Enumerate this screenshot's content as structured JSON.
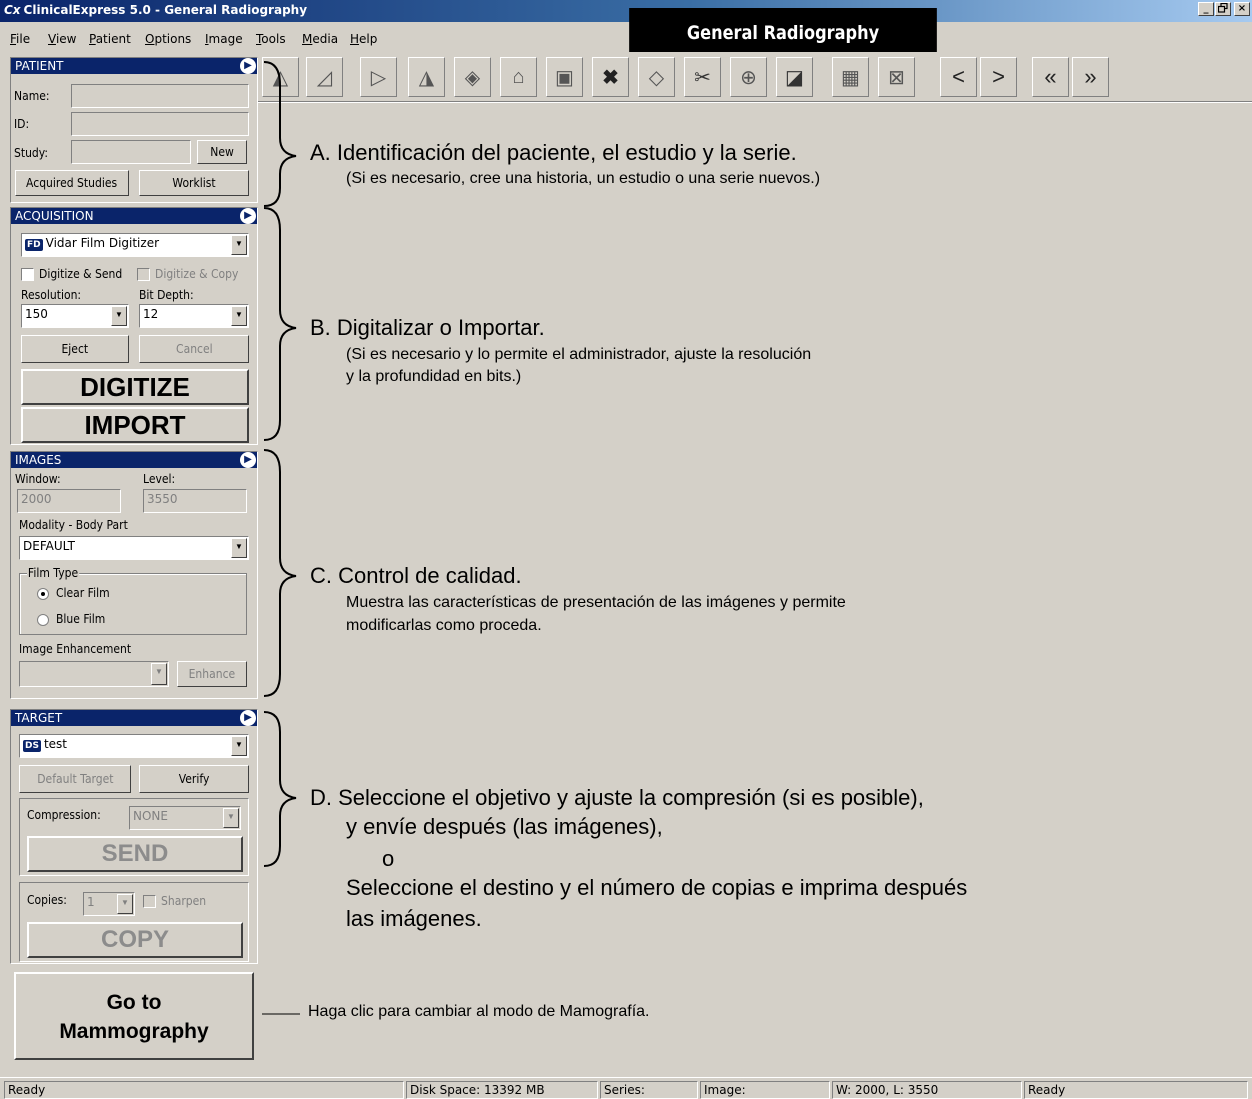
{
  "window": {
    "title": "ClinicalExpress 5.0 - General Radiography",
    "icon_glyph": "Cx",
    "minimize": "_",
    "restore": "Р",
    "close": "×"
  },
  "menu": [
    "File",
    "View",
    "Patient",
    "Options",
    "Image",
    "Tools",
    "Media",
    "Help"
  ],
  "mode_banner": "General Radiography",
  "toolbar": {
    "tools": [
      "flip-horizontal-icon",
      "rotate-icon",
      "arrow-icon",
      "mirror-icon",
      "fit-icon",
      "home-icon",
      "page-icon",
      "delete-icon",
      "fill-icon",
      "tools-icon",
      "zoom-icon",
      "label-icon",
      "grid-icon",
      "crosshair-icon"
    ],
    "nav": [
      "<",
      ">",
      "«",
      "»"
    ]
  },
  "patient": {
    "header": "PATIENT",
    "name_label": "Name:",
    "id_label": "ID:",
    "study_label": "Study:",
    "new_button": "New",
    "acquired_button": "Acquired Studies",
    "worklist_button": "Worklist"
  },
  "acquisition": {
    "header": "ACQUISITION",
    "device_badge": "FD",
    "device": "Vidar Film Digitizer",
    "digitize_send": "Digitize & Send",
    "digitize_copy": "Digitize & Copy",
    "resolution_label": "Resolution:",
    "resolution": "150",
    "bitdepth_label": "Bit Depth:",
    "bitdepth": "12",
    "eject": "Eject",
    "cancel": "Cancel",
    "digitize": "DIGITIZE",
    "import": "IMPORT"
  },
  "images": {
    "header": "IMAGES",
    "window_label": "Window:",
    "window": "2000",
    "level_label": "Level:",
    "level": "3550",
    "modality_label": "Modality - Body Part",
    "modality": "DEFAULT",
    "film_type_label": "Film Type",
    "clear_film": "Clear Film",
    "blue_film": "Blue Film",
    "enhancement_label": "Image Enhancement",
    "enhance_button": "Enhance"
  },
  "target": {
    "header": "TARGET",
    "badge": "DS",
    "value": "test",
    "default_target": "Default Target",
    "verify": "Verify",
    "compression_label": "Compression:",
    "compression": "NONE",
    "send": "SEND",
    "copies_label": "Copies:",
    "copies": "1",
    "sharpen": "Sharpen",
    "copy": "COPY"
  },
  "mammo_button": [
    "Go to",
    "Mammography"
  ],
  "annotations": {
    "a_title": "A.  Identificación del paciente, el estudio y la serie.",
    "a_note": "(Si es necesario, cree una historia, un estudio o una serie nuevos.)",
    "b_title": "B.  Digitalizar o Importar.",
    "b_note1": "(Si es necesario y lo permite el administrador, ajuste la resolución",
    "b_note2": "y la profundidad en bits.)",
    "c_title": "C.  Control de calidad.",
    "c_note1": "Muestra las características de presentación de las imágenes y permite",
    "c_note2": "modificarlas como proceda.",
    "d_line1": "D.  Seleccione el objetivo y ajuste la compresión (si es posible),",
    "d_line2": "y envíe después (las imágenes),",
    "d_line3": "o",
    "d_line4": "Seleccione el destino y el número de copias e imprima después",
    "d_line5": "las imágenes.",
    "mammo_note": "Haga clic para cambiar al modo de Mamografía."
  },
  "status": {
    "left": "Ready",
    "disk": "Disk Space: 13392 MB",
    "series": "Series:",
    "image": "Image:",
    "wl": "W: 2000, L: 3550",
    "right": "Ready"
  }
}
